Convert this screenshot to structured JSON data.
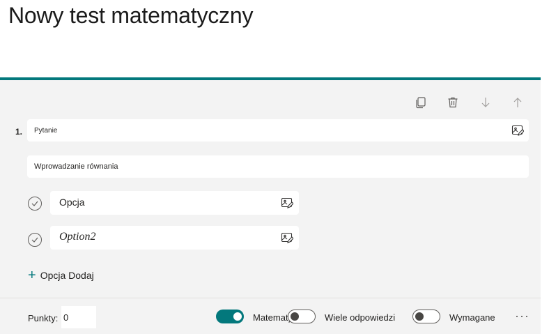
{
  "form": {
    "title": "Nowy test matematyczny"
  },
  "toolbar": {
    "icons": [
      "copy-icon",
      "delete-icon",
      "move-down-icon",
      "move-up-icon"
    ]
  },
  "question": {
    "number": "1.",
    "placeholder": "Pytanie",
    "equation_placeholder": "Wprowadzanie równania"
  },
  "options": [
    {
      "text": "Opcja"
    },
    {
      "text": "Option2"
    }
  ],
  "add_option_label": "Opcja Dodaj",
  "footer": {
    "points_label": "Punkty:",
    "points_value": "0",
    "math_label": "Matematyka",
    "math_on": true,
    "multi_label": "Wiele odpowiedzi",
    "multi_on": false,
    "required_label": "Wymagane",
    "required_on": false,
    "more_label": "···"
  },
  "colors": {
    "accent": "#03787c",
    "card_bg": "#f3f3f3"
  }
}
